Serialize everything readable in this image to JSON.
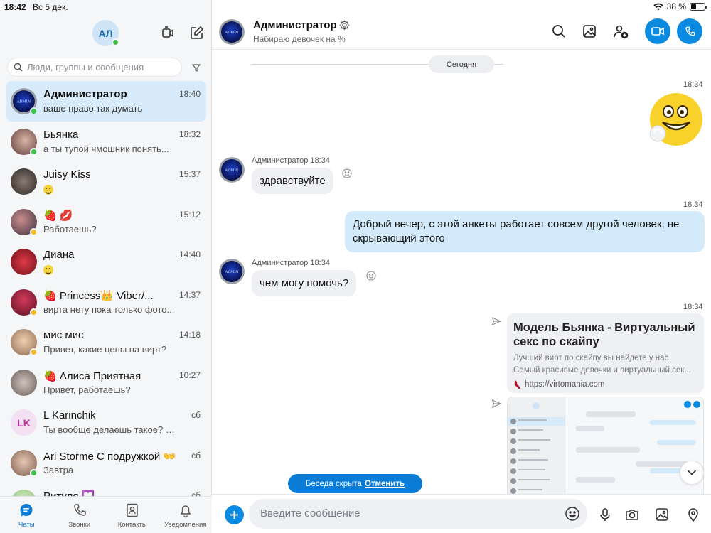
{
  "status_bar": {
    "time": "18:42",
    "date": "Вс 5 дек.",
    "battery": "38 %",
    "battery_level": 0.38
  },
  "me": {
    "initials": "АЛ"
  },
  "search": {
    "placeholder": "Люди, группы и сообщения"
  },
  "chats": [
    {
      "name": "Администратор",
      "time": "18:40",
      "preview": "ваше право так думать",
      "presence": "online",
      "active": true
    },
    {
      "name": "Бьянка",
      "time": "18:32",
      "preview": "а ты тупой чмошник понять...",
      "presence": "online"
    },
    {
      "name": "Juisy Kiss",
      "time": "15:37",
      "preview": "",
      "preview_emoji": true
    },
    {
      "name": "🍓 💋",
      "time": "15:12",
      "preview": "Работаешь?",
      "presence": "away"
    },
    {
      "name": "Диана",
      "time": "14:40",
      "preview": "",
      "preview_emoji": true
    },
    {
      "name": "🍓 Princess👑 Viber/...",
      "time": "14:37",
      "preview": "вирта нету пока только фото...",
      "presence": "away"
    },
    {
      "name": "мис мис",
      "time": "14:18",
      "preview": "Привет, какие цены на вирт?",
      "presence": "away"
    },
    {
      "name": "🍓 Алиса Приятная",
      "time": "10:27",
      "preview": "Привет, работаешь?"
    },
    {
      "name": "L Karinchik",
      "time": "сб",
      "preview": "Ты вообще делаешь такое? Есл...",
      "initials": "LK"
    },
    {
      "name": "Ari Storme С подружкой 👐",
      "time": "сб",
      "preview": "Завтра",
      "presence": "online"
    },
    {
      "name": "Ритуля 💟",
      "time": "сб",
      "preview": ""
    }
  ],
  "nav": [
    {
      "label": "Чаты",
      "icon": "chat-icon",
      "active": true
    },
    {
      "label": "Звонки",
      "icon": "phone-icon"
    },
    {
      "label": "Контакты",
      "icon": "contacts-icon"
    },
    {
      "label": "Уведомления",
      "icon": "bell-icon"
    }
  ],
  "conversation": {
    "title": "Администратор",
    "subtitle": "Набираю девочек на %",
    "date_separator": "Сегодня",
    "messages": {
      "m1_time": "18:34",
      "m2_sender": "Администратор 18:34",
      "m2_text": "здравствуйте",
      "m3_time": "18:34",
      "m3_text": "Добрый вечер, с этой анкеты работает совсем другой человек, не скрывающий этого",
      "m4_sender": "Администратор 18:34",
      "m4_text": "чем могу помочь?",
      "m5_time": "18:34"
    },
    "link_preview": {
      "title": "Модель Бьянка - Виртуальный секс по скайпу",
      "description_1": "Лучший вирт по скайпу вы найдете у нас.",
      "description_2": "Самый красивые девочки и виртуальный сек...",
      "url": "https://virtomania.com"
    }
  },
  "toast": {
    "text": "Беседа скрыта",
    "undo": "Отменить"
  },
  "composer": {
    "placeholder": "Введите сообщение"
  },
  "colors": {
    "accent": "#0a8ae0",
    "active_row": "#d7ebfa",
    "online": "#3ac246",
    "away": "#f6b71a"
  }
}
